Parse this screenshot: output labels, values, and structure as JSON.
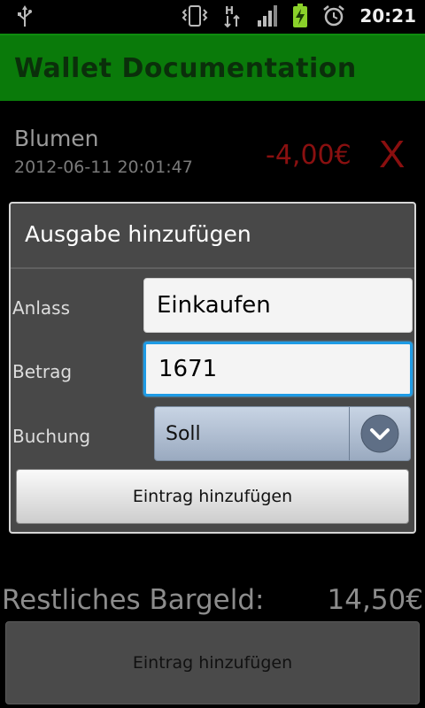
{
  "status_bar": {
    "time": "20:21",
    "network_letter": "H"
  },
  "app": {
    "title": "Wallet Documentation"
  },
  "entry": {
    "name": "Blumen",
    "date": "2012-06-11 20:01:47",
    "amount": "-4,00€",
    "delete_label": "X"
  },
  "dialog": {
    "title": "Ausgabe hinzufügen",
    "anlass_label": "Anlass",
    "anlass_value": "Einkaufen",
    "betrag_label": "Betrag",
    "betrag_value": "1671",
    "buchung_label": "Buchung",
    "buchung_value": "Soll",
    "submit_label": "Eintrag hinzufügen"
  },
  "summary": {
    "label": "Restliches Bargeld:",
    "value": "14,50€"
  },
  "bottom_button": {
    "label": "Eintrag hinzufügen"
  },
  "colors": {
    "title_bar": "#0a7a0a",
    "focus": "#1e9be5",
    "negative": "#8a1010"
  }
}
